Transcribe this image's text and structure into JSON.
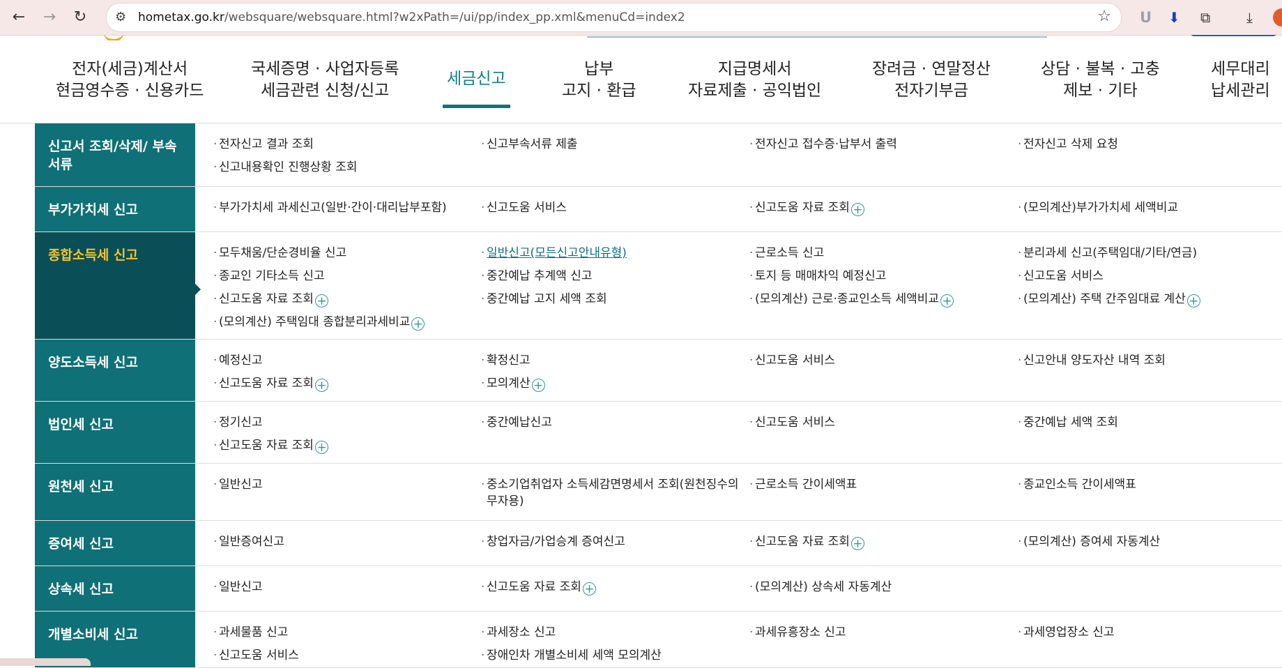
{
  "browser": {
    "url_host": "hometax.go.kr",
    "url_path": "/websquare/websquare.html?w2xPath=/ui/pp/index_pp.xml&menuCd=index2",
    "ext_u_label": "U"
  },
  "nav": [
    {
      "line1": "전자(세금)계산서",
      "line2": "현금영수증 · 신용카드"
    },
    {
      "line1": "국세증명 · 사업자등록",
      "line2": "세금관련 신청/신고"
    },
    {
      "line1": "세금신고",
      "line2": ""
    },
    {
      "line1": "납부",
      "line2": "고지 · 환급"
    },
    {
      "line1": "지급명세서",
      "line2": "자료제출 · 공익법인"
    },
    {
      "line1": "장려금 · 연말정산",
      "line2": "전자기부금"
    },
    {
      "line1": "상담 · 불복 · 고충",
      "line2": "제보 · 기타"
    },
    {
      "line1": "세무대리",
      "line2": "납세관리"
    }
  ],
  "menu": {
    "rows": [
      {
        "title": "신고서 조회/삭제/ 부속서류",
        "cols": [
          [
            "전자신고 결과 조회",
            "신고내용확인 진행상황 조회"
          ],
          [
            "신고부속서류 제출"
          ],
          [
            "전자신고 접수증·납부서 출력"
          ],
          [
            "전자신고 삭제 요청"
          ]
        ]
      },
      {
        "title": "부가가치세 신고",
        "cols": [
          [
            "부가가치세 과세신고(일반·간이·대리납부포함)"
          ],
          [
            "신고도움 서비스"
          ],
          [
            "신고도움 자료 조회"
          ],
          [
            "(모의계산)부가가치세 세액비교"
          ]
        ]
      },
      {
        "title": "종합소득세 신고",
        "cols": [
          [
            "모두채움/단순경비율 신고",
            "종교인 기타소득 신고",
            "신고도움 자료 조회",
            "(모의계산) 주택임대 종합분리과세비교"
          ],
          [
            "일반신고(모든신고안내유형)",
            "중간예납 추계액 신고",
            "중간예납 고지 세액 조회"
          ],
          [
            "근로소득 신고",
            "토지 등 매매차익 예정신고",
            "(모의계산) 근로·종교인소득 세액비교"
          ],
          [
            "분리과세 신고(주택임대/기타/연금)",
            "신고도움 서비스",
            "(모의계산) 주택 간주임대료 계산"
          ]
        ]
      },
      {
        "title": "양도소득세 신고",
        "cols": [
          [
            "예정신고",
            "신고도움 자료 조회"
          ],
          [
            "확정신고",
            "모의계산"
          ],
          [
            "신고도움 서비스"
          ],
          [
            "신고안내 양도자산 내역 조회"
          ]
        ]
      },
      {
        "title": "법인세 신고",
        "cols": [
          [
            "정기신고",
            "신고도움 자료 조회"
          ],
          [
            "중간예납신고"
          ],
          [
            "신고도움 서비스"
          ],
          [
            "중간예납 세액 조회"
          ]
        ]
      },
      {
        "title": "원천세 신고",
        "cols": [
          [
            "일반신고"
          ],
          [
            "중소기업취업자 소득세감면명세서 조회(원천징수의무자용)"
          ],
          [
            "근로소득 간이세액표"
          ],
          [
            "종교인소득 간이세액표"
          ]
        ]
      },
      {
        "title": "증여세 신고",
        "cols": [
          [
            "일반증여신고"
          ],
          [
            "창업자금/가업승계 증여신고"
          ],
          [
            "신고도움 자료 조회"
          ],
          [
            "(모의계산) 증여세 자동계산"
          ]
        ]
      },
      {
        "title": "상속세 신고",
        "cols": [
          [
            "일반신고"
          ],
          [
            "신고도움 자료 조회"
          ],
          [
            "(모의계산) 상속세 자동계산"
          ],
          []
        ]
      },
      {
        "title": "개별소비세 신고",
        "cols": [
          [
            "과세물품 신고",
            "신고도움 서비스"
          ],
          [
            "과세장소 신고",
            "장애인차 개별소비세 세액 모의계산"
          ],
          [
            "과세유흥장소 신고"
          ],
          [
            "과세영업장소 신고"
          ]
        ]
      }
    ]
  },
  "colors": {
    "row_header": "#0f7077",
    "row_header_active": "#0a4f57",
    "active_title": "#f6c42a",
    "nav_active": "#0d7f8a"
  }
}
